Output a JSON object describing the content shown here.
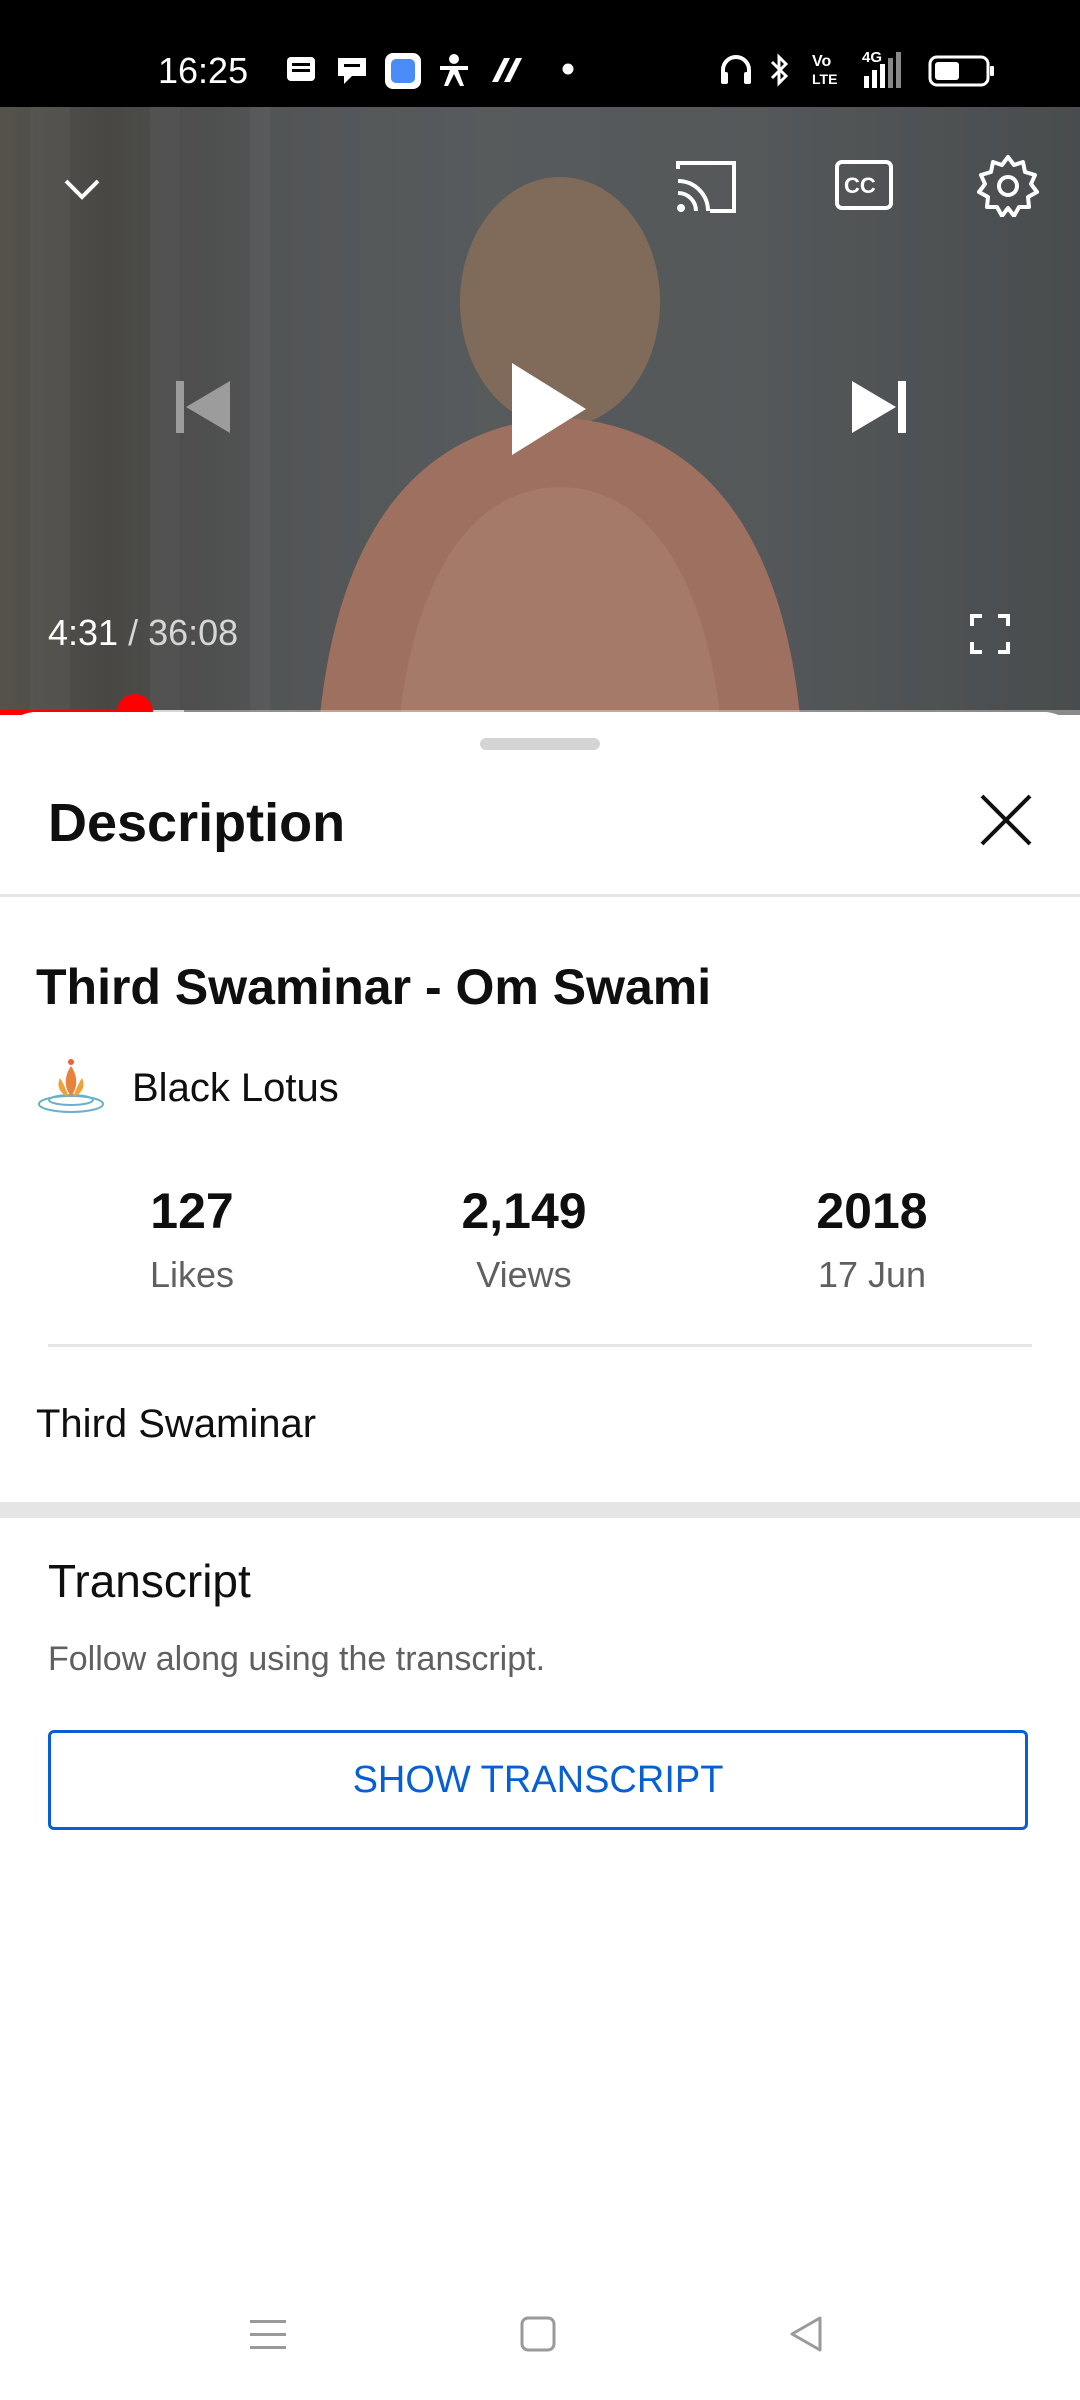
{
  "status_bar": {
    "time": "16:25",
    "icons": [
      "message-icon",
      "chat-icon",
      "app-icon",
      "accessibility-icon",
      "app-icon-2",
      "dot-icon",
      "headphones-icon",
      "bluetooth-icon",
      "volte-icon",
      "signal-4g-icon",
      "battery-icon"
    ],
    "volte_label": "Vo LTE",
    "network_label": "4G"
  },
  "player": {
    "current_time": "4:31",
    "separator": " / ",
    "duration": "36:08",
    "progress_fraction": 0.125,
    "buffered_fraction": 0.17,
    "controls": [
      "minimize-icon",
      "cast-icon",
      "captions-icon",
      "settings-icon",
      "previous-icon",
      "play-icon",
      "next-icon",
      "fullscreen-icon"
    ],
    "accent_color": "#ff0000"
  },
  "description_panel": {
    "title": "Description",
    "video_title": "Third Swaminar - Om Swami",
    "channel_name": "Black Lotus",
    "stats": [
      {
        "value": "127",
        "label": "Likes"
      },
      {
        "value": "2,149",
        "label": "Views"
      },
      {
        "value": "2018",
        "label": "17 Jun"
      }
    ],
    "description_text": "Third Swaminar"
  },
  "transcript": {
    "title": "Transcript",
    "subtitle": "Follow along using the transcript.",
    "button_label": "SHOW TRANSCRIPT",
    "button_color": "#065fd4"
  },
  "nav_bar": {
    "buttons": [
      "menu-icon",
      "home-icon",
      "back-icon"
    ]
  }
}
